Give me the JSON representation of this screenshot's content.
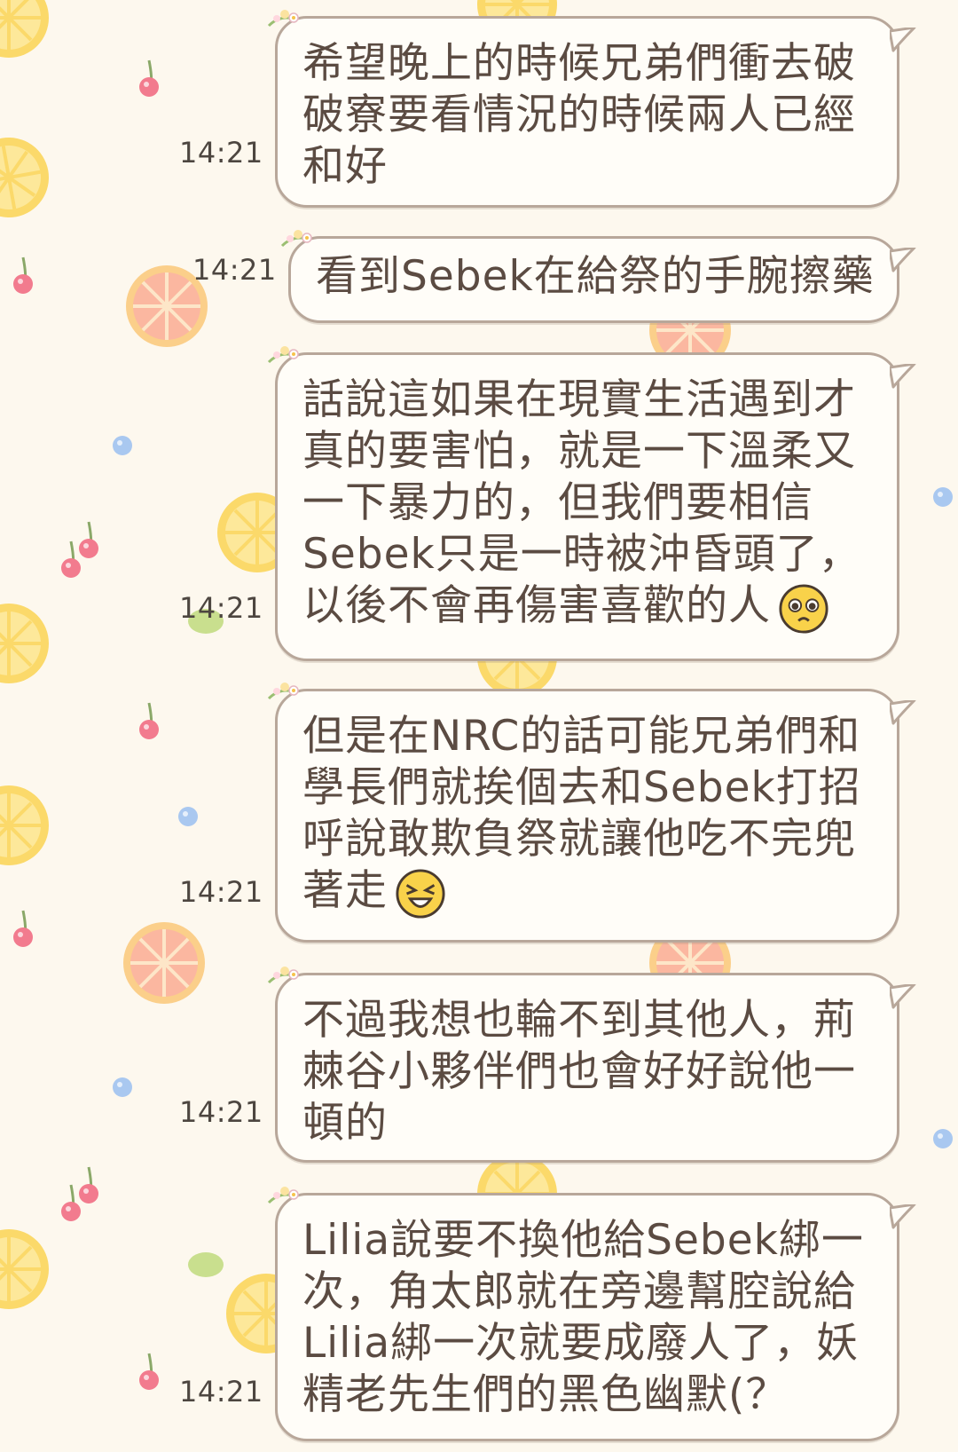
{
  "messages": [
    {
      "time": "14:21",
      "text": "希望晚上的時候兄弟們衝去破\n破寮要看情況的時候兩人已經\n和好",
      "emoji": ""
    },
    {
      "time": "14:21",
      "text": "看到Sebek在給祭的手腕擦藥",
      "emoji": ""
    },
    {
      "time": "14:21",
      "text": "話說這如果在現實生活遇到才\n真的要害怕，就是一下溫柔又\n一下暴力的，但我們要相信\nSebek只是一時被沖昏頭了，\n以後不會再傷害喜歡的人",
      "emoji": "pleading-face-icon"
    },
    {
      "time": "14:21",
      "text": "但是在NRC的話可能兄弟們和\n學長們就挨個去和Sebek打招\n呼說敢欺負祭就讓他吃不完兜\n著走",
      "emoji": "laughing-face-icon"
    },
    {
      "time": "14:21",
      "text": "不過我想也輪不到其他人，荊\n棘谷小夥伴們也會好好說他一\n頓的",
      "emoji": ""
    },
    {
      "time": "14:21",
      "text": "Lilia說要不換他給Sebek綁一\n次，角太郎就在旁邊幫腔說給\nLilia綁一次就要成廢人了，妖\n精老先生們的黑色幽默(？",
      "emoji": ""
    }
  ],
  "colors": {
    "bubble_border": "#b8a79a",
    "bubble_fill": "#fffdf8",
    "text": "#5b4b42",
    "time": "#4d4640",
    "background": "#fdf8ee"
  }
}
